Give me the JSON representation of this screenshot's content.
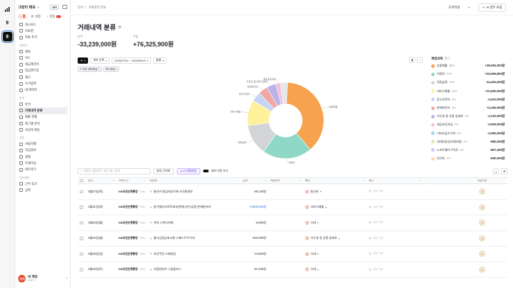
{
  "workspace": {
    "name": "그린티 테오",
    "api": "API"
  },
  "modes": [
    {
      "label": "홈",
      "active": true
    },
    {
      "label": "설정",
      "active": false
    },
    {
      "label": "알림",
      "active": false
    }
  ],
  "nav_top": [
    {
      "label": "대시보드"
    },
    {
      "label": "지표판"
    },
    {
      "label": "목표 추가"
    }
  ],
  "sections": [
    {
      "title": "데이터",
      "items": [
        "계좌",
        "카드",
        "세금계산서",
        "현금영수증",
        "재고",
        "수기입력",
        "내 데이터"
      ]
    },
    {
      "title": "분석",
      "items": [
        "분석",
        "거래내역 분류",
        "매출 현황",
        "태그별 분석",
        "자산의 변동"
      ]
    },
    {
      "title": "업무",
      "items": [
        "사용자별",
        "자금일보",
        "결재",
        "트레이딩",
        "네트워크"
      ]
    },
    {
      "title": "인사관리",
      "items": [
        "근무·휴가",
        "급여"
      ]
    }
  ],
  "active_nav": "거래내역 분류",
  "user": {
    "name": "내 계정",
    "sub": "소유자",
    "avatar": "그린티"
  },
  "breadcrumb": [
    "분석",
    "거래내역 분류"
  ],
  "support": "고객지원",
  "ai_button": "AI 업무 요청",
  "page_title": "거래내역 분류",
  "stats": [
    {
      "label": "순익",
      "value": "-33,239,000원"
    },
    {
      "label": "수입",
      "value": "+76,325,900원"
    }
  ],
  "filters": {
    "count": "1",
    "account": "계좌 선택",
    "range": "2025/07/01 ~ 2026/06/19",
    "period": "월별"
  },
  "filter_tags": [
    {
      "prefix": "자금",
      "label": "계좌/현금"
    },
    {
      "label": "카드/현금"
    }
  ],
  "chart_data": {
    "type": "pie",
    "slices": [
      {
        "label": "상품매출",
        "value": 38,
        "color": "#f6a24f"
      },
      {
        "label": "이용료",
        "value": 21,
        "color": "#8fd8c6"
      },
      {
        "label": "직원급여",
        "value": 13,
        "color": "#d3d4d8"
      },
      {
        "label": "서비스매출",
        "value": 11,
        "color": "#fdf19a"
      },
      {
        "label": "광고선전비",
        "value": 4,
        "color": "#c6d4f5"
      },
      {
        "label": "판매촉진비",
        "value": 4,
        "color": "#f1a7a3"
      },
      {
        "label": "사무실 및 공용 임대료",
        "value": 4,
        "color": "#b9b3e8"
      },
      {
        "label": "세금과공과금",
        "value": 2,
        "color": "#f4c1d8"
      },
      {
        "label": "기타",
        "value": 3,
        "color": "#e5e6ea"
      }
    ],
    "slice_labels": [
      "상품매출",
      "이용료",
      "직원급여",
      "서비스매출",
      "광고선전비",
      "판매촉진비",
      "사무실 및 공용 임대료",
      "세금과공과금"
    ]
  },
  "panel": {
    "title": "계정과목",
    "sub": "태그",
    "rows": [
      {
        "label": "상품매출",
        "pct": "38%",
        "value": "+38,294,000원",
        "color": "#f6a24f"
      },
      {
        "label": "이용료",
        "pct": "21%",
        "value": "+20,659,800원",
        "color": "#8fd8c6"
      },
      {
        "label": "직원급여",
        "pct": "13%",
        "value": "-14,400,000원",
        "color": "#d3d4d8"
      },
      {
        "label": "서비스매출",
        "pct": "11%",
        "value": "+11,840,000원",
        "color": "#fdf19a"
      },
      {
        "label": "광고선전비",
        "pct": "4%",
        "value": "-4,410,000원",
        "color": "#c6d4f5"
      },
      {
        "label": "판매촉진비",
        "pct": "4%",
        "value": "+4,160,000원",
        "color": "#f1a7a3"
      },
      {
        "label": "사무실 및 공용 임대료",
        "pct": "4%",
        "value": "-4,120,000원",
        "color": "#b9b3e8"
      },
      {
        "label": "세금과공과금",
        "pct": "2%",
        "value": "-2,506,000원",
        "color": "#f4c1d8"
      },
      {
        "label": "기타지급수수료",
        "pct": "2%",
        "value": "-2,080,000원",
        "color": "#9fd3f0"
      },
      {
        "label": "지대부동산(4대보험)",
        "pct": "1%",
        "value": "-980,000원",
        "color": "#d7ecb0"
      },
      {
        "label": "소프트웨어구독료",
        "pct": "1%",
        "value": "-897,400원",
        "color": "#c8c8f2"
      },
      {
        "label": "인건비",
        "pct": "1%",
        "value": "-840,000원",
        "color": "#ffd8a8"
      }
    ]
  },
  "search": {
    "placeholder": "사용처, 계정과목, 서비, 태그 검색",
    "rule_btn": "분류 규칙화",
    "ai_btn": "AI 계정분류",
    "toggle": "제외 내역 보기"
  },
  "columns": [
    "일시",
    "거래수단",
    "사용처",
    "금액",
    "계정과목",
    "메모",
    "태그",
    "사용자전"
  ],
  "rows": [
    {
      "date": "3월27일(화)",
      "bank": "KB국민은행통장",
      "acct": "7194",
      "payee": "통신비 발급자동이체-사닥통관료",
      "amount": "-69,100원",
      "cat": "통신비",
      "memo": "사용 작성",
      "tag": "-",
      "pos": false
    },
    {
      "date": "3월31일(화)",
      "bank": "KB국민은행통장",
      "acct": "7194",
      "payee": "분기별추가료로제조(판매)-분기금정-판매관리비",
      "amount": "+3,800,000원",
      "cat": "서비스매출",
      "memo": "사용 작성",
      "tag": "-",
      "pos": true
    },
    {
      "date": "3월30일(월)",
      "bank": "KB국민은행통장",
      "acct": "7194",
      "payee": "커피 스케이카페",
      "amount": "-5,900원",
      "cat": "식대",
      "memo": "사용 작성",
      "tag": "-",
      "pos": false
    },
    {
      "date": "3월30일(월)",
      "bank": "KB국민은행통장",
      "acct": "7194",
      "payee": "월기금장급표시통-스페스트우이내",
      "amount": "-520,000원",
      "cat": "사무실 및 공용 임대료",
      "memo": "사용 작성",
      "tag": "-",
      "pos": false
    },
    {
      "date": "3월29일(일)",
      "bank": "KB국민은행통장",
      "acct": "7194",
      "payee": "지인주문-스배달업",
      "amount": "-24,900원",
      "cat": "식대",
      "memo": "사용 작성",
      "tag": "-",
      "pos": false
    },
    {
      "date": "3월26일(토)",
      "bank": "KB국민은행통장",
      "acct": "7194",
      "payee": "더힐한닭가-스플플러스",
      "amount": "-57,200원",
      "cat": "식대",
      "memo": "사용 작성",
      "tag": "-",
      "pos": false
    }
  ]
}
